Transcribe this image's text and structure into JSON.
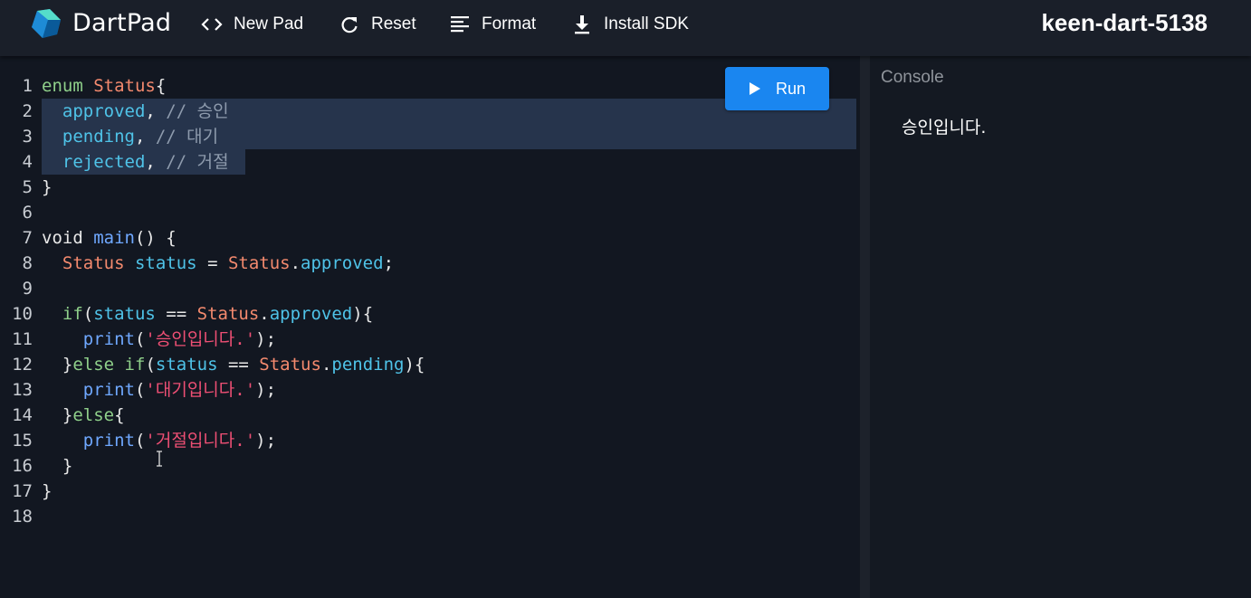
{
  "header": {
    "app_title": "DartPad",
    "logo_icon": "dart-logo-icon",
    "buttons": [
      {
        "label": "New Pad",
        "icon": "code-brackets-icon"
      },
      {
        "label": "Reset",
        "icon": "refresh-icon"
      },
      {
        "label": "Format",
        "icon": "format-align-icon"
      },
      {
        "label": "Install SDK",
        "icon": "download-icon"
      }
    ],
    "pad_name": "keen-dart-5138"
  },
  "editor": {
    "run_label": "Run",
    "selected_lines": [
      2,
      3,
      4
    ],
    "lines": [
      {
        "n": "1",
        "tokens": [
          {
            "t": "enum ",
            "c": "kw-green"
          },
          {
            "t": "Status",
            "c": "typ"
          },
          {
            "t": "{",
            "c": ""
          }
        ]
      },
      {
        "n": "2",
        "tokens": [
          {
            "t": "  ",
            "c": ""
          },
          {
            "t": "approved",
            "c": "fld"
          },
          {
            "t": ", ",
            "c": ""
          },
          {
            "t": "// 승인",
            "c": "cmt"
          }
        ]
      },
      {
        "n": "3",
        "tokens": [
          {
            "t": "  ",
            "c": ""
          },
          {
            "t": "pending",
            "c": "fld"
          },
          {
            "t": ", ",
            "c": ""
          },
          {
            "t": "// 대기",
            "c": "cmt"
          }
        ]
      },
      {
        "n": "4",
        "tokens": [
          {
            "t": "  ",
            "c": ""
          },
          {
            "t": "rejected",
            "c": "fld"
          },
          {
            "t": ", ",
            "c": ""
          },
          {
            "t": "// 거절",
            "c": "cmt"
          }
        ]
      },
      {
        "n": "5",
        "tokens": [
          {
            "t": "}",
            "c": ""
          }
        ]
      },
      {
        "n": "6",
        "tokens": []
      },
      {
        "n": "7",
        "tokens": [
          {
            "t": "void ",
            "c": ""
          },
          {
            "t": "main",
            "c": "fn"
          },
          {
            "t": "() {",
            "c": ""
          }
        ]
      },
      {
        "n": "8",
        "tokens": [
          {
            "t": "  ",
            "c": ""
          },
          {
            "t": "Status",
            "c": "typ"
          },
          {
            "t": " ",
            "c": ""
          },
          {
            "t": "status",
            "c": "fld"
          },
          {
            "t": " = ",
            "c": ""
          },
          {
            "t": "Status",
            "c": "typ"
          },
          {
            "t": ".",
            "c": ""
          },
          {
            "t": "approved",
            "c": "fld"
          },
          {
            "t": ";",
            "c": ""
          }
        ]
      },
      {
        "n": "9",
        "tokens": []
      },
      {
        "n": "10",
        "tokens": [
          {
            "t": "  ",
            "c": ""
          },
          {
            "t": "if",
            "c": "kw-green"
          },
          {
            "t": "(",
            "c": ""
          },
          {
            "t": "status",
            "c": "fld"
          },
          {
            "t": " == ",
            "c": ""
          },
          {
            "t": "Status",
            "c": "typ"
          },
          {
            "t": ".",
            "c": ""
          },
          {
            "t": "approved",
            "c": "fld"
          },
          {
            "t": "){",
            "c": ""
          }
        ]
      },
      {
        "n": "11",
        "tokens": [
          {
            "t": "    ",
            "c": ""
          },
          {
            "t": "print",
            "c": "fn"
          },
          {
            "t": "(",
            "c": ""
          },
          {
            "t": "'승인입니다.'",
            "c": "str"
          },
          {
            "t": ");",
            "c": ""
          }
        ]
      },
      {
        "n": "12",
        "tokens": [
          {
            "t": "  }",
            "c": ""
          },
          {
            "t": "else",
            "c": "kw-green"
          },
          {
            "t": " ",
            "c": ""
          },
          {
            "t": "if",
            "c": "kw-green"
          },
          {
            "t": "(",
            "c": ""
          },
          {
            "t": "status",
            "c": "fld"
          },
          {
            "t": " == ",
            "c": ""
          },
          {
            "t": "Status",
            "c": "typ"
          },
          {
            "t": ".",
            "c": ""
          },
          {
            "t": "pending",
            "c": "fld"
          },
          {
            "t": "){",
            "c": ""
          }
        ]
      },
      {
        "n": "13",
        "tokens": [
          {
            "t": "    ",
            "c": ""
          },
          {
            "t": "print",
            "c": "fn"
          },
          {
            "t": "(",
            "c": ""
          },
          {
            "t": "'대기입니다.'",
            "c": "str"
          },
          {
            "t": ");",
            "c": ""
          }
        ]
      },
      {
        "n": "14",
        "tokens": [
          {
            "t": "  }",
            "c": ""
          },
          {
            "t": "else",
            "c": "kw-green"
          },
          {
            "t": "{",
            "c": ""
          }
        ]
      },
      {
        "n": "15",
        "tokens": [
          {
            "t": "    ",
            "c": ""
          },
          {
            "t": "print",
            "c": "fn"
          },
          {
            "t": "(",
            "c": ""
          },
          {
            "t": "'거절입니다.'",
            "c": "str"
          },
          {
            "t": ");",
            "c": ""
          }
        ]
      },
      {
        "n": "16",
        "tokens": [
          {
            "t": "  }",
            "c": ""
          }
        ]
      },
      {
        "n": "17",
        "tokens": [
          {
            "t": "}",
            "c": ""
          }
        ]
      },
      {
        "n": "18",
        "tokens": []
      }
    ]
  },
  "console": {
    "label": "Console",
    "output": "승인입니다."
  },
  "colors": {
    "accent": "#1a86f0",
    "background": "#121721",
    "selection": "#26344c"
  }
}
